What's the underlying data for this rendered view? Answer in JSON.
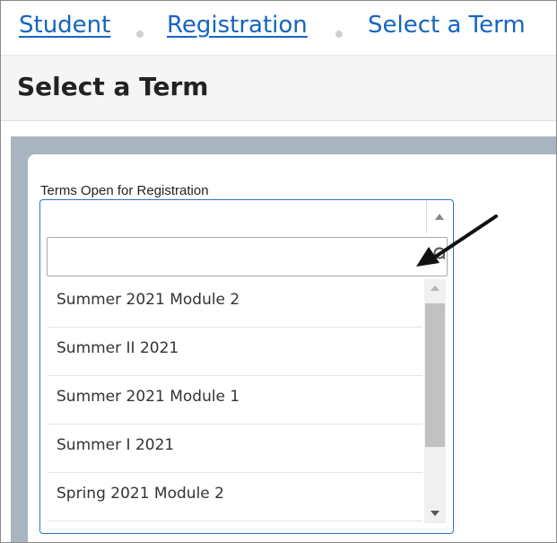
{
  "breadcrumb": {
    "items": [
      {
        "label": "Student"
      },
      {
        "label": "Registration"
      },
      {
        "label": "Select a Term"
      }
    ]
  },
  "page": {
    "title": "Select a Term"
  },
  "term_field": {
    "label": "Terms Open for Registration",
    "selected_value": "",
    "search_value": "",
    "options": [
      "Summer 2021 Module 2",
      "Summer II 2021",
      "Summer 2021 Module 1",
      "Summer I 2021",
      "Spring 2021 Module 2"
    ]
  },
  "colors": {
    "link": "#1565c0",
    "focus_border": "#2b74c4",
    "content_background": "#a8b4c0"
  },
  "icons": {
    "dropdown": "dropdown-arrow-icon",
    "search": "search-icon",
    "scroll_up": "scroll-up-arrow-icon",
    "scroll_down": "scroll-down-arrow-icon",
    "annotation": "annotation-arrow-icon"
  }
}
